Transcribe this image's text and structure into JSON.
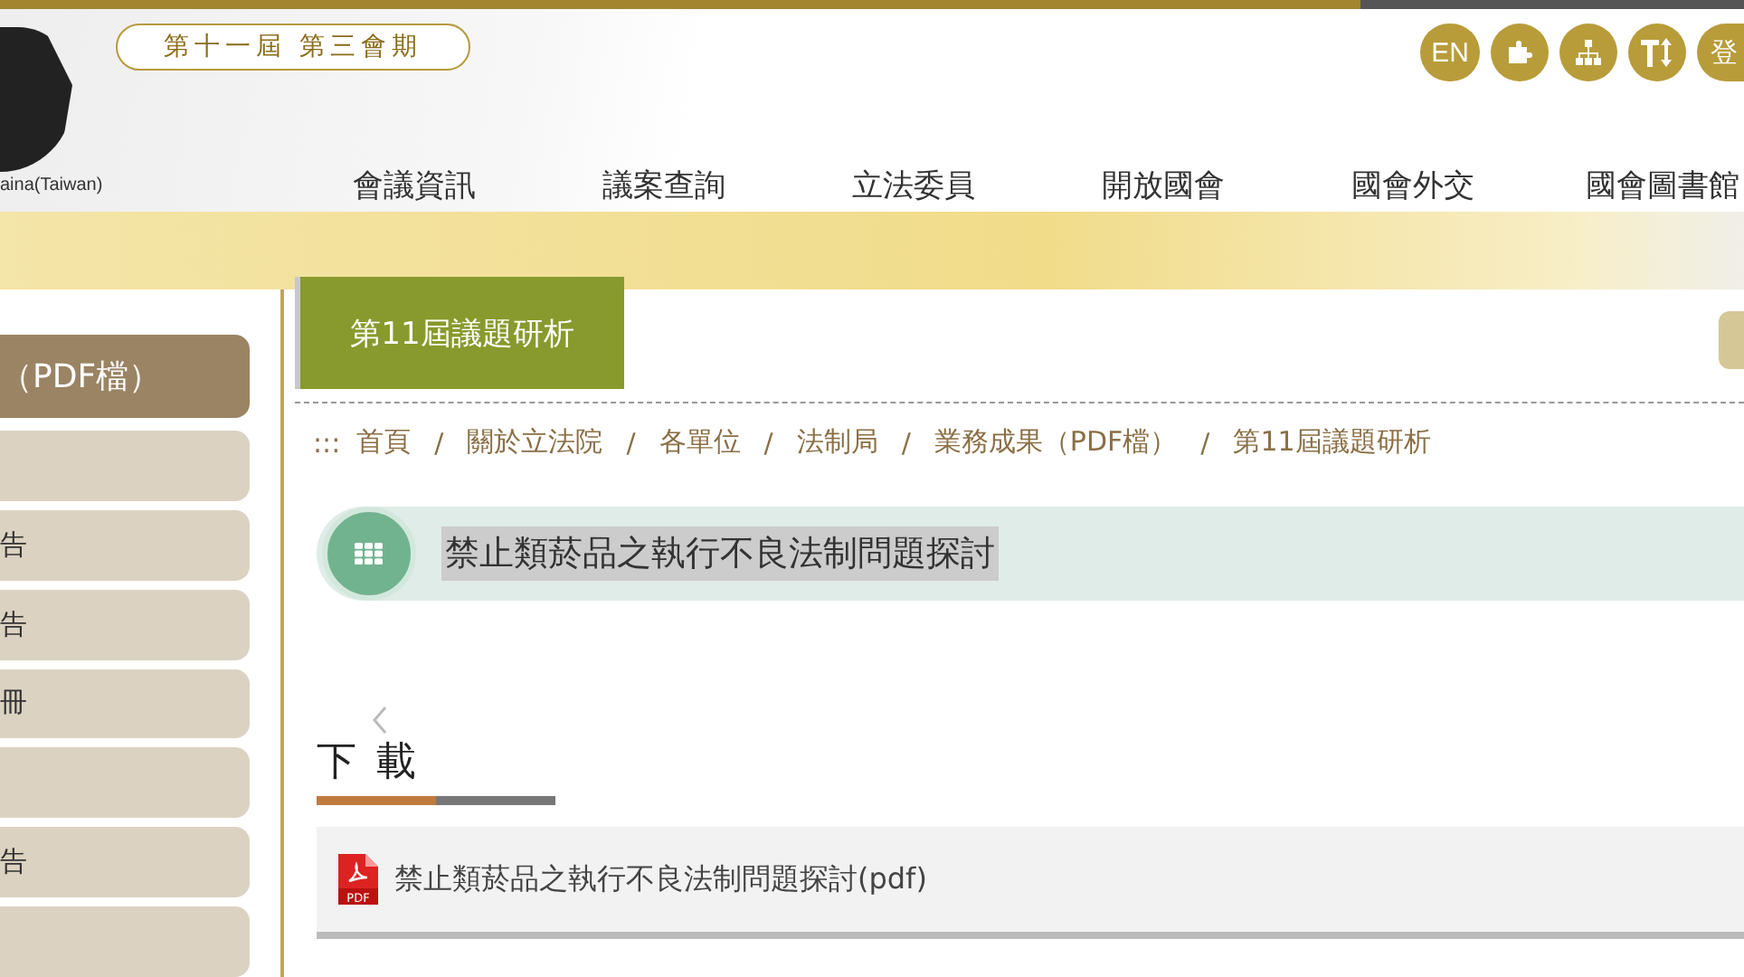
{
  "header": {
    "logo_caption": "aina(Taiwan)",
    "session_badge": "第十一屆 第三會期",
    "tools": [
      {
        "kind": "text",
        "label": "EN"
      },
      {
        "kind": "puzzle"
      },
      {
        "kind": "sitemap"
      },
      {
        "kind": "font-size"
      },
      {
        "kind": "text",
        "label": "登"
      }
    ],
    "nav": [
      "會議資訊",
      "議案查詢",
      "立法委員",
      "開放國會",
      "國會外交",
      "國會圖書館"
    ]
  },
  "sidebar": {
    "items": [
      {
        "label": "（PDF檔）",
        "selected": true
      },
      {
        "selected": false
      },
      {
        "label": "告",
        "selected": false
      },
      {
        "label": "告",
        "selected": false
      },
      {
        "label": "冊",
        "selected": false
      },
      {
        "selected": false
      },
      {
        "label": "告",
        "selected": false
      },
      {
        "selected": false
      }
    ]
  },
  "page_title": "第11屆議題研析",
  "breadcrumb": {
    "marker": ":::",
    "separator": "/",
    "items": [
      "首頁",
      "關於立法院",
      "各單位",
      "法制局",
      "業務成果（PDF檔）",
      "第11屆議題研析"
    ]
  },
  "topic": "禁止類菸品之執行不良法制問題探討",
  "download": {
    "heading": "下 載",
    "files": [
      {
        "kind": "pdf",
        "icon_label": "PDF",
        "name": "禁止類菸品之執行不良法制問題探討(pdf)"
      }
    ]
  }
}
